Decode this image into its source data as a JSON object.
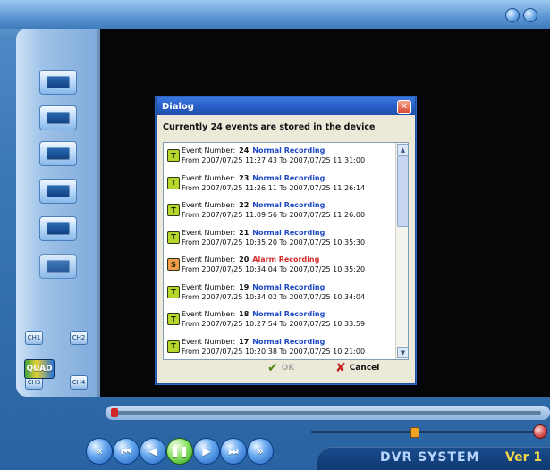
{
  "dialog": {
    "title": "Dialog",
    "close_symbol": "✕",
    "summary": "Currently 24 events are stored in the device",
    "events": [
      {
        "icon_letter": "T",
        "icon_color": "#b7d62a",
        "number": "24",
        "kind": "Normal Recording",
        "kind_color": "#1d49c4",
        "range": "From 2007/07/25 11:27:43 To 2007/07/25 11:31:00"
      },
      {
        "icon_letter": "T",
        "icon_color": "#b7d62a",
        "number": "23",
        "kind": "Normal Recording",
        "kind_color": "#1d49c4",
        "range": "From 2007/07/25 11:26:11 To 2007/07/25 11:26:14"
      },
      {
        "icon_letter": "T",
        "icon_color": "#b7d62a",
        "number": "22",
        "kind": "Normal Recording",
        "kind_color": "#1d49c4",
        "range": "From 2007/07/25 11:09:56 To 2007/07/25 11:26:00"
      },
      {
        "icon_letter": "T",
        "icon_color": "#b7d62a",
        "number": "21",
        "kind": "Normal Recording",
        "kind_color": "#1d49c4",
        "range": "From 2007/07/25 10:35:20 To 2007/07/25 10:35:30"
      },
      {
        "icon_letter": "S",
        "icon_color": "#f09a4a",
        "number": "20",
        "kind": "Alarm Recording",
        "kind_color": "#d12b2b",
        "range": "From 2007/07/25 10:34:04 To 2007/07/25 10:35:20"
      },
      {
        "icon_letter": "T",
        "icon_color": "#b7d62a",
        "number": "19",
        "kind": "Normal Recording",
        "kind_color": "#1d49c4",
        "range": "From 2007/07/25 10:34:02 To 2007/07/25 10:34:04"
      },
      {
        "icon_letter": "T",
        "icon_color": "#b7d62a",
        "number": "18",
        "kind": "Normal Recording",
        "kind_color": "#1d49c4",
        "range": "From 2007/07/25 10:27:54 To 2007/07/25 10:33:59"
      },
      {
        "icon_letter": "T",
        "icon_color": "#b7d62a",
        "number": "17",
        "kind": "Normal Recording",
        "kind_color": "#1d49c4",
        "range": "From 2007/07/25 10:20:38 To 2007/07/25 10:21:00"
      }
    ],
    "event_prefix": "Event Number:",
    "ok_label": "OK",
    "cancel_label": "Cancel"
  },
  "cameras": {
    "ch1": "CH1",
    "ch2": "CH2",
    "ch3": "CH3",
    "ch4": "CH4",
    "quad": "QUAD"
  },
  "brand": {
    "name": "DVR SYSTEM",
    "version": "Ver 1"
  },
  "volume_level": 0.46,
  "icons": [
    "minimize-icon",
    "close-icon",
    "camera-icon",
    "playback-icon",
    "backup-icon",
    "search-icon",
    "settings-icon",
    "disk-icon",
    "first-icon",
    "prev-icon",
    "reverse-icon",
    "pause-icon",
    "play-icon",
    "next-icon",
    "last-icon",
    "volume-icon"
  ]
}
